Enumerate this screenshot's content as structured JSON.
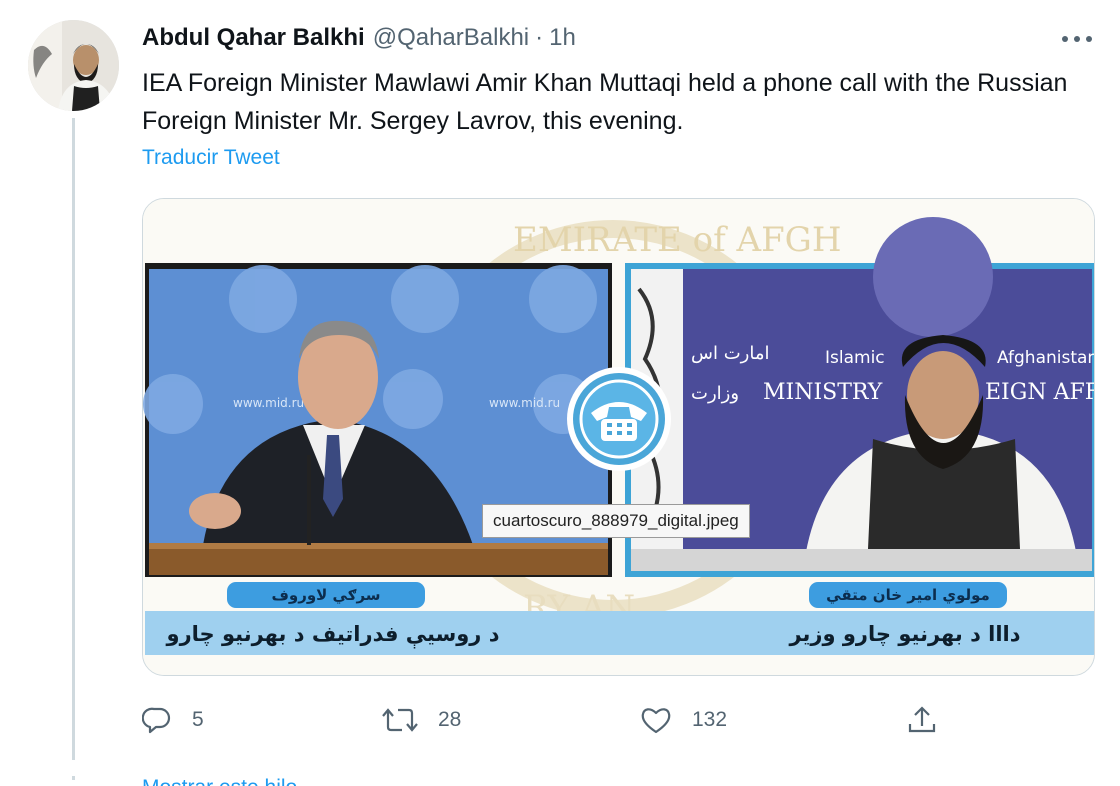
{
  "tweet": {
    "author_name": "Abdul Qahar Balkhi",
    "handle": "@QaharBalkhi",
    "separator": "·",
    "time": "1h",
    "text": "IEA Foreign Minister Mawlawi Amir Khan Muttaqi held a phone call with the Russian Foreign Minister Mr. Sergey Lavrov, this evening.",
    "translate_label": "Traducir Tweet",
    "more_icon": "more-horizontal-icon"
  },
  "media": {
    "tooltip": "cuartoscuro_888979_digital.jpeg",
    "watermark_top": "EMIRATE of AFGH",
    "watermark_bottom": "RY  AN",
    "left_panel": {
      "backdrop_text_1": "www.mid.ru",
      "backdrop_text_2": "www.mid.ru",
      "name_label": "سرګي لاوروف",
      "caption": "د روسيې فدراتيف د بهرنيو چارو"
    },
    "right_panel": {
      "backdrop_arabic_1": "امارت اس",
      "backdrop_arabic_2": "وزارت",
      "backdrop_latin_1": "Islamic",
      "backdrop_latin_2": "Afghanistan",
      "backdrop_ministry": "MINISTRY",
      "backdrop_ministry_end": "EIGN AFF",
      "name_label": "مولوي امير خان متقي",
      "caption": "دااا د بهرنيو چارو وزير"
    },
    "center_icon": "telephone-icon",
    "accent": "#4aa6d8",
    "caption_bg": "#9fd0ef",
    "label_bg": "#3d9de0"
  },
  "actions": {
    "reply_count": "5",
    "retweet_count": "28",
    "like_count": "132",
    "reply_icon": "reply-icon",
    "retweet_icon": "retweet-icon",
    "like_icon": "heart-icon",
    "share_icon": "share-icon"
  },
  "show_more": "Mostrar este hilo"
}
